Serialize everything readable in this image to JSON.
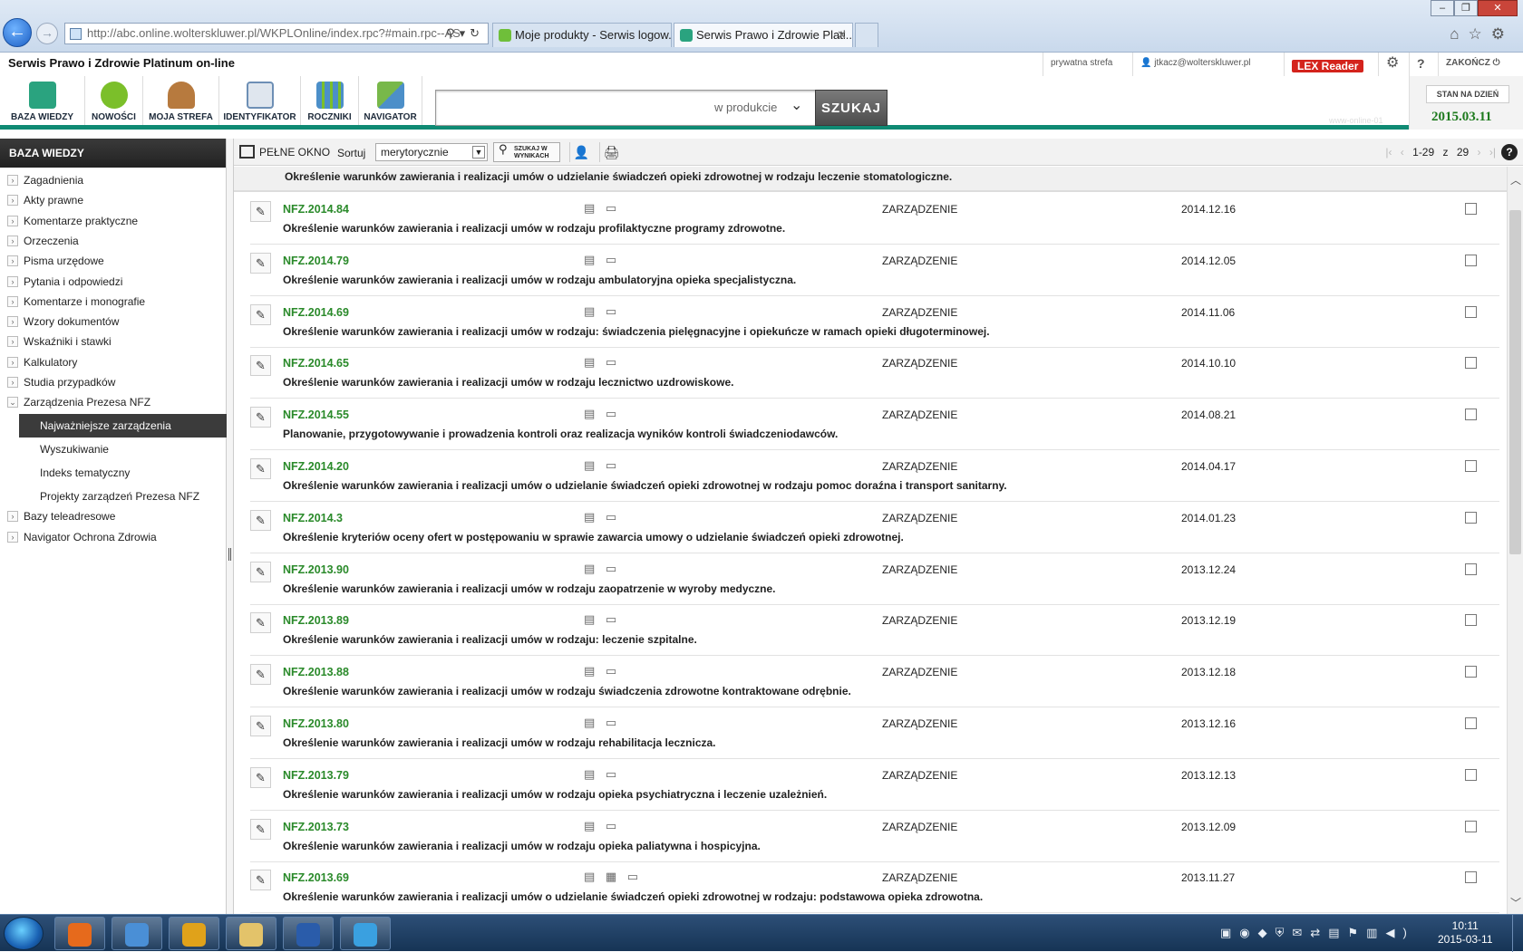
{
  "browser": {
    "address": "http://abc.online.wolterskluwer.pl/WKPLOnline/index.rpc?#main.rpc--AS",
    "tabs": [
      {
        "label": "Moje produkty - Serwis logow..."
      },
      {
        "label": "Serwis Prawo i Zdrowie Plati..."
      }
    ],
    "window_controls": [
      "–",
      "❐",
      "✕"
    ]
  },
  "header": {
    "app_title": "Serwis Prawo i Zdrowie Platinum on-line",
    "private_zone": "prywatna strefa",
    "user": "jtkacz@wolterskluwer.pl",
    "lex_reader": "LEX Reader",
    "logout": "ZAKOŃCZ"
  },
  "toolbar": {
    "buttons": [
      {
        "label": "BAZA WIEDZY",
        "icon": "knowledge-base-icon",
        "color": "#2aa37f"
      },
      {
        "label": "NOWOŚCI",
        "icon": "news-icon",
        "color": "#7bbf2a"
      },
      {
        "label": "MOJA STREFA",
        "icon": "user-zone-icon",
        "color": "#b77a3e"
      },
      {
        "label": "IDENTYFIKATOR",
        "icon": "identifier-icon",
        "color": "#6d8fb5"
      },
      {
        "label": "ROCZNIKI",
        "icon": "yearbooks-icon",
        "color": "#4c8fc9"
      },
      {
        "label": "NAVIGATOR",
        "icon": "navigator-icon",
        "color": "#78b84a"
      }
    ],
    "search": {
      "value": "",
      "scope": "w produkcie",
      "button": "SZUKAJ"
    },
    "status_date_label": "STAN NA DZIEŃ",
    "status_date": "2015.03.11",
    "server_tag": "www-online-01"
  },
  "sidebar": {
    "title": "BAZA WIEDZY",
    "items": [
      {
        "label": "Zagadnienia",
        "toggle": "›"
      },
      {
        "label": "Akty prawne",
        "toggle": "›"
      },
      {
        "label": "Komentarze praktyczne",
        "toggle": "›"
      },
      {
        "label": "Orzeczenia",
        "toggle": "›"
      },
      {
        "label": "Pisma urzędowe",
        "toggle": "›"
      },
      {
        "label": "Pytania i odpowiedzi",
        "toggle": "›"
      },
      {
        "label": "Komentarze i monografie",
        "toggle": "›"
      },
      {
        "label": "Wzory dokumentów",
        "toggle": "›"
      },
      {
        "label": "Wskaźniki i stawki",
        "toggle": "›"
      },
      {
        "label": "Kalkulatory",
        "toggle": "›"
      },
      {
        "label": "Studia przypadków",
        "toggle": "›"
      },
      {
        "label": "Zarządzenia Prezesa NFZ",
        "toggle": "⌄"
      }
    ],
    "subitems": [
      {
        "label": "Najważniejsze zarządzenia",
        "active": true
      },
      {
        "label": "Wyszukiwanie",
        "active": false
      },
      {
        "label": "Indeks tematyczny",
        "active": false
      },
      {
        "label": "Projekty zarządzeń Prezesa NFZ",
        "active": false
      }
    ],
    "items_after": [
      {
        "label": "Bazy teleadresowe",
        "toggle": "›"
      },
      {
        "label": "Navigator Ochrona Zdrowia",
        "toggle": "›"
      }
    ]
  },
  "content_toolbar": {
    "full_window": "PEŁNE OKNO",
    "sort_label": "Sortuj",
    "sort_value": "merytorycznie",
    "search_in_results": "SZUKAJ W WYNIKACH",
    "pager": "1-29 z 29"
  },
  "list": {
    "partial_title": "Określenie warunków zawierania i realizacji umów o udzielanie świadczeń opieki zdrowotnej w rodzaju leczenie stomatologiczne.",
    "rows": [
      {
        "code": "NFZ.2014.84",
        "type": "ZARZĄDZENIE",
        "date": "2014.12.16",
        "title": "Określenie warunków zawierania i realizacji umów w rodzaju profilaktyczne programy zdrowotne."
      },
      {
        "code": "NFZ.2014.79",
        "type": "ZARZĄDZENIE",
        "date": "2014.12.05",
        "title": "Określenie warunków zawierania i realizacji umów w rodzaju ambulatoryjna opieka specjalistyczna."
      },
      {
        "code": "NFZ.2014.69",
        "type": "ZARZĄDZENIE",
        "date": "2014.11.06",
        "title": "Określenie warunków zawierania i realizacji umów w rodzaju: świadczenia pielęgnacyjne i opiekuńcze w ramach opieki długoterminowej."
      },
      {
        "code": "NFZ.2014.65",
        "type": "ZARZĄDZENIE",
        "date": "2014.10.10",
        "title": "Określenie warunków zawierania i realizacji umów w rodzaju lecznictwo uzdrowiskowe."
      },
      {
        "code": "NFZ.2014.55",
        "type": "ZARZĄDZENIE",
        "date": "2014.08.21",
        "title": "Planowanie, przygotowywanie i prowadzenia kontroli oraz realizacja wyników kontroli świadczeniodawców."
      },
      {
        "code": "NFZ.2014.20",
        "type": "ZARZĄDZENIE",
        "date": "2014.04.17",
        "title": "Określenie warunków zawierania i realizacji umów o udzielanie świadczeń opieki zdrowotnej w rodzaju pomoc doraźna i transport sanitarny."
      },
      {
        "code": "NFZ.2014.3",
        "type": "ZARZĄDZENIE",
        "date": "2014.01.23",
        "title": "Określenie kryteriów oceny ofert w postępowaniu w sprawie zawarcia umowy o udzielanie świadczeń opieki zdrowotnej."
      },
      {
        "code": "NFZ.2013.90",
        "type": "ZARZĄDZENIE",
        "date": "2013.12.24",
        "title": "Określenie warunków zawierania i realizacji umów w rodzaju zaopatrzenie w wyroby medyczne."
      },
      {
        "code": "NFZ.2013.89",
        "type": "ZARZĄDZENIE",
        "date": "2013.12.19",
        "title": "Określenie warunków zawierania i realizacji umów w rodzaju: leczenie szpitalne."
      },
      {
        "code": "NFZ.2013.88",
        "type": "ZARZĄDZENIE",
        "date": "2013.12.18",
        "title": "Określenie warunków zawierania i realizacji umów w rodzaju świadczenia zdrowotne kontraktowane odrębnie."
      },
      {
        "code": "NFZ.2013.80",
        "type": "ZARZĄDZENIE",
        "date": "2013.12.16",
        "title": "Określenie warunków zawierania i realizacji umów w rodzaju rehabilitacja lecznicza."
      },
      {
        "code": "NFZ.2013.79",
        "type": "ZARZĄDZENIE",
        "date": "2013.12.13",
        "title": "Określenie warunków zawierania i realizacji umów w rodzaju opieka psychiatryczna i leczenie uzależnień."
      },
      {
        "code": "NFZ.2013.73",
        "type": "ZARZĄDZENIE",
        "date": "2013.12.09",
        "title": "Określenie warunków zawierania i realizacji umów w rodzaju opieka paliatywna i hospicyjna."
      },
      {
        "code": "NFZ.2013.69",
        "type": "ZARZĄDZENIE",
        "date": "2013.11.27",
        "title": "Określenie warunków zawierania i realizacji umów o udzielanie świadczeń opieki zdrowotnej w rodzaju: podstawowa opieka zdrowotna."
      }
    ]
  },
  "taskbar": {
    "apps": [
      {
        "name": "firefox",
        "color": "#e66a1c"
      },
      {
        "name": "remote-desktop",
        "color": "#4a8fd6"
      },
      {
        "name": "outlook",
        "color": "#e0a21a"
      },
      {
        "name": "explorer",
        "color": "#e3c36a"
      },
      {
        "name": "word",
        "color": "#2a5caa"
      },
      {
        "name": "internet-explorer",
        "color": "#3aa0e0"
      }
    ],
    "time": "10:11",
    "date": "2015-03-11"
  }
}
